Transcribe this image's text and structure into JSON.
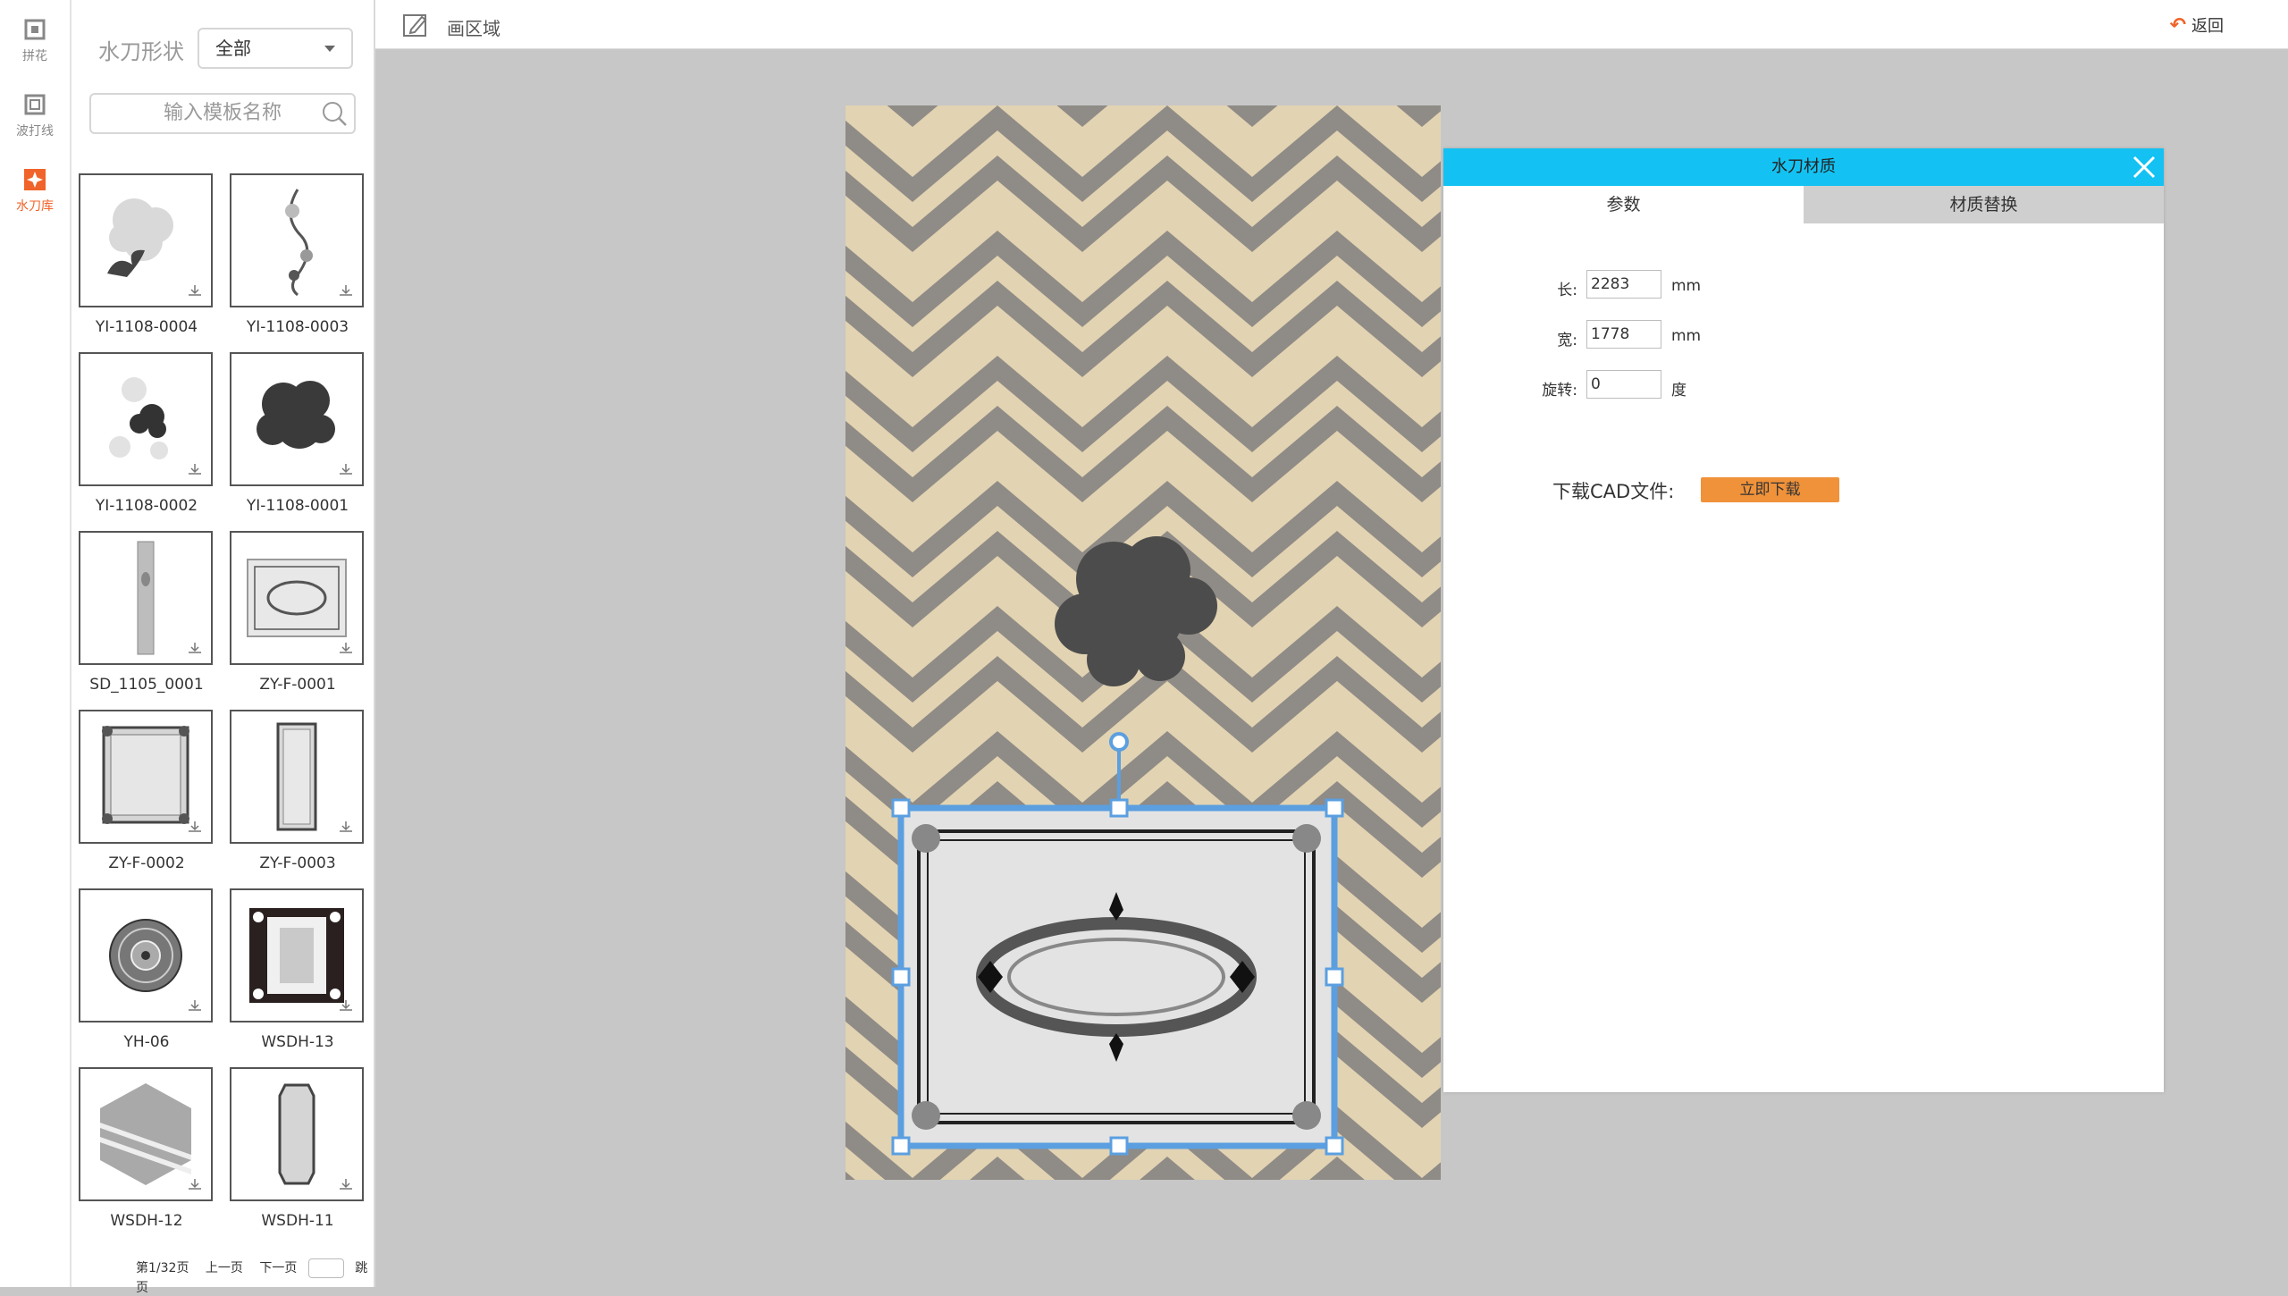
{
  "rail": {
    "items": [
      {
        "label": "拼花",
        "icon": "mosaic-icon",
        "active": false
      },
      {
        "label": "波打线",
        "icon": "border-line-icon",
        "active": false
      },
      {
        "label": "水刀库",
        "icon": "waterjet-library-icon",
        "active": true
      }
    ]
  },
  "library": {
    "shape_label": "水刀形状",
    "shape_select": "全部",
    "search_placeholder": "输入模板名称",
    "tiles": [
      {
        "name": "YI-1108-0004"
      },
      {
        "name": "YI-1108-0003"
      },
      {
        "name": "YI-1108-0002"
      },
      {
        "name": "YI-1108-0001"
      },
      {
        "name": "SD_1105_0001"
      },
      {
        "name": "ZY-F-0001"
      },
      {
        "name": "ZY-F-0002"
      },
      {
        "name": "ZY-F-0003"
      },
      {
        "name": "YH-06"
      },
      {
        "name": "WSDH-13"
      },
      {
        "name": "WSDH-12"
      },
      {
        "name": "WSDH-11"
      }
    ],
    "pager": {
      "page": "第1/32页",
      "prev": "上一页",
      "next": "下一页",
      "jump": "跳页"
    }
  },
  "topbar": {
    "draw_label": "画区域",
    "back_label": "返回"
  },
  "dialog": {
    "title": "水刀材质",
    "tabs": [
      {
        "label": "参数",
        "active": true
      },
      {
        "label": "材质替换",
        "active": false
      }
    ],
    "fields": [
      {
        "label": "长:",
        "value": "2283",
        "unit": "mm"
      },
      {
        "label": "宽:",
        "value": "1778",
        "unit": "mm"
      },
      {
        "label": "旋转:",
        "value": "0",
        "unit": "度"
      }
    ],
    "cad_label": "下载CAD文件:",
    "cad_button": "立即下载"
  },
  "colors": {
    "accent": "#f0632a",
    "header": "#13c2f2",
    "selection": "#5b9fe0",
    "button": "#f0923a"
  }
}
